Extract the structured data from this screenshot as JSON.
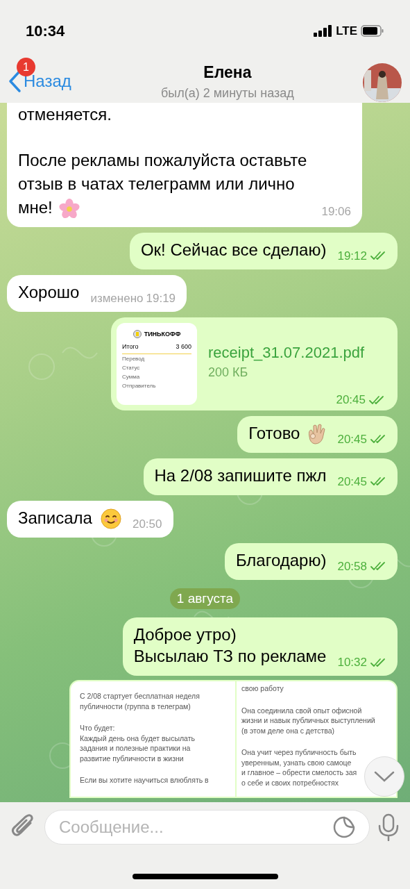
{
  "status_bar": {
    "time": "10:34",
    "network": "LTE"
  },
  "header": {
    "back_label": "Назад",
    "badge": "1",
    "title": "Елена",
    "subtitle": "был(а) 2 минуты назад"
  },
  "messages": [
    {
      "kind": "text",
      "outgoing": false,
      "paragraphs": [
        "отменяется.",
        "После рекламы пожалуйста оставьте отзыв в чатах телеграмм или лично мне!"
      ],
      "emoji": {
        "kind": "flower"
      },
      "time": "19:06",
      "cut_top": true
    },
    {
      "kind": "text",
      "outgoing": true,
      "paragraphs": [
        "Ок! Сейчас все сделаю)"
      ],
      "time": "19:12",
      "read": true
    },
    {
      "kind": "text",
      "outgoing": false,
      "paragraphs": [
        "Хорошо"
      ],
      "edited": "изменено",
      "time": "19:19"
    },
    {
      "kind": "file",
      "outgoing": true,
      "filename": "receipt_31.07.2021.pdf",
      "size": "200 КБ",
      "time": "20:45",
      "read": true,
      "thumb": {
        "brand": "ТИНЬКОФФ",
        "total_label": "Итого",
        "total": "3 600",
        "rows": [
          "Перевод",
          "Статус",
          "Сумма",
          "Отправитель"
        ]
      }
    },
    {
      "kind": "text",
      "outgoing": true,
      "paragraphs": [
        "Готово"
      ],
      "emoji": {
        "kind": "ok-hand"
      },
      "time": "20:45",
      "read": true
    },
    {
      "kind": "text",
      "outgoing": true,
      "paragraphs": [
        "На 2/08 запишите пжл"
      ],
      "time": "20:45",
      "read": true
    },
    {
      "kind": "text",
      "outgoing": false,
      "paragraphs": [
        "Записала"
      ],
      "emoji": {
        "kind": "smile"
      },
      "time": "20:50"
    },
    {
      "kind": "text",
      "outgoing": true,
      "paragraphs": [
        "Благодарю)"
      ],
      "time": "20:58",
      "read": true
    },
    {
      "kind": "date",
      "label": "1 августа"
    },
    {
      "kind": "text",
      "outgoing": true,
      "paragraphs": [
        "Доброе утро)\nВысылаю ТЗ по рекламе"
      ],
      "time": "10:32",
      "read": true
    },
    {
      "kind": "document",
      "outgoing": true,
      "left": [
        "С 2/08 стартует бесплатная неделя\nпубличности (группа в телеграм)",
        "Что будет:\nКаждый день она будет высылать\nзадания и полезные практики на\nразвитие публичности в жизни",
        "Если вы хотите научиться влюблять в"
      ],
      "right": [
        "свою работу",
        "Она соединила свой опыт офисной\nжизни и навык публичных выступлений\n(в этом деле она с детства)",
        "Она учит через публичность быть\nуверенным, узнать свою самоце\nи главное – обрести смелость зая\nо себе и своих потребностях"
      ]
    }
  ],
  "composer": {
    "placeholder": "Сообщение..."
  }
}
